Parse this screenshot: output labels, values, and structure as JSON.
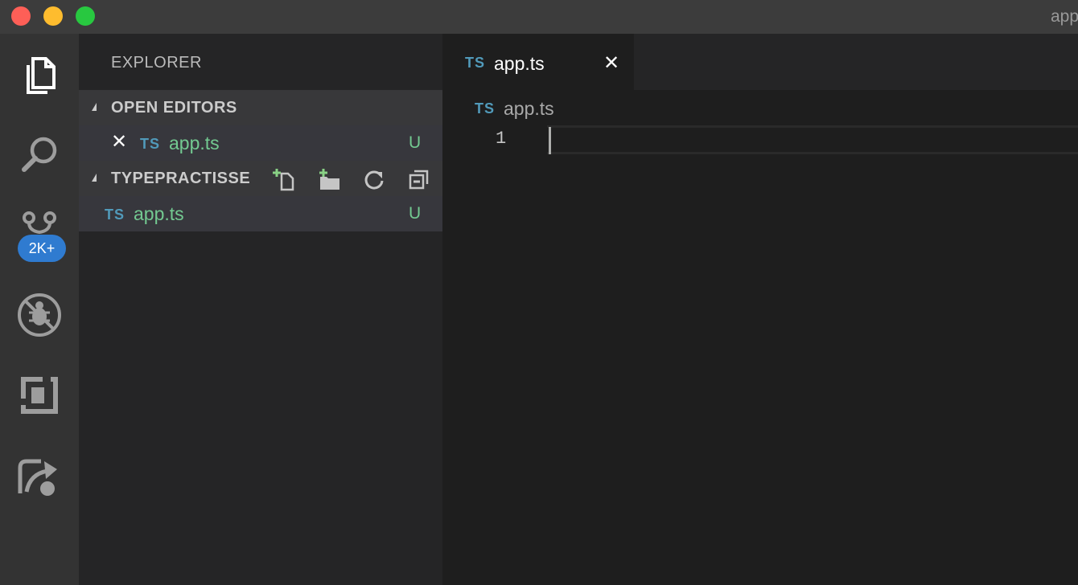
{
  "window": {
    "title": "app.ts"
  },
  "activity_bar": {
    "items": [
      "files-icon",
      "search-icon",
      "source-control-icon",
      "debug-icon",
      "extensions-icon",
      "remote-share-icon"
    ],
    "source_control_badge": "2K+"
  },
  "sidebar": {
    "title": "EXPLORER",
    "open_editors": {
      "header": "OPEN EDITORS",
      "items": [
        {
          "lang": "TS",
          "name": "app.ts",
          "status": "U"
        }
      ]
    },
    "project": {
      "header": "TYPEPRACTISSE",
      "tools": [
        "new-file-icon",
        "new-folder-icon",
        "refresh-icon",
        "collapse-all-icon"
      ],
      "files": [
        {
          "lang": "TS",
          "name": "app.ts",
          "status": "U"
        }
      ]
    }
  },
  "editor": {
    "tabs": [
      {
        "lang": "TS",
        "label": "app.ts",
        "close": "✕"
      }
    ],
    "breadcrumb": {
      "lang": "TS",
      "label": "app.ts"
    },
    "lines": [
      {
        "number": "1",
        "content": ""
      }
    ]
  },
  "colors": {
    "ts_icon": "#519aba",
    "untracked": "#73c991",
    "badge": "#2f7bd0"
  }
}
